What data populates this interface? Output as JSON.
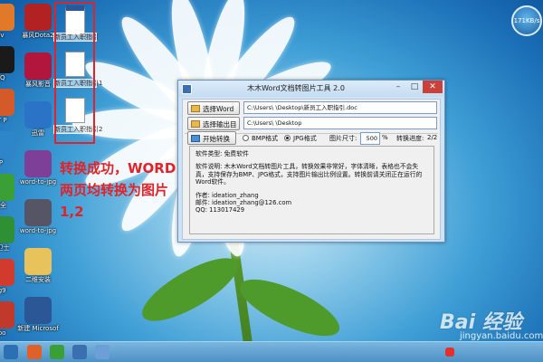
{
  "desktop": {
    "left_icons": [
      {
        "label": "ffv",
        "icon": "app-icon",
        "color": "#e07a2a"
      },
      {
        "label": "QQ",
        "icon": "qq-icon",
        "color": "#1a1a1a"
      },
      {
        "label": "ET P",
        "icon": "office-icon",
        "color": "#d55a2a"
      },
      {
        "label": "iP",
        "icon": "ie-icon",
        "color": "#2d86c9"
      },
      {
        "label": "安全",
        "icon": "security-icon",
        "color": "#3aa035"
      },
      {
        "label": "全卫士",
        "icon": "shield-icon",
        "color": "#2f8f34"
      },
      {
        "label": "eg9",
        "icon": "app-icon",
        "color": "#d03b2e"
      },
      {
        "label": "ypo",
        "icon": "app-icon",
        "color": "#c0392b"
      }
    ],
    "col2_icons": [
      {
        "label": "暴风Dota2",
        "icon": "dota-icon",
        "color": "#b22222"
      },
      {
        "label": "暴风影音",
        "icon": "media-player-icon",
        "color": "#b3163c"
      },
      {
        "label": "迅雷",
        "icon": "thunder-icon",
        "color": "#2a73c7"
      },
      {
        "label": "word-to-jpg",
        "icon": "winrar-icon",
        "color": "#7e3f98"
      },
      {
        "label": "word-to-jpg",
        "icon": "image-icon",
        "color": "#556"
      },
      {
        "label": "二维安装",
        "icon": "folder-icon",
        "color": "#e8c25a"
      },
      {
        "label": "新建 Microsof",
        "icon": "word-icon",
        "color": "#2b5797"
      }
    ],
    "doc_icons": [
      {
        "label": "新员工入职指引",
        "icon": "word-doc-icon"
      },
      {
        "label": "新员工入职指引1",
        "icon": "image-doc-icon"
      },
      {
        "label": "新员工入职指引2",
        "icon": "image-doc-icon"
      }
    ],
    "annotation": [
      "转换成功，WORD",
      "两页均转换为图片",
      "1,2"
    ],
    "speed": "171KB/s"
  },
  "window": {
    "title": "木木Word文档转图片工具 2.0",
    "select_word_button": "选择Word文件",
    "select_output_button": "选择输出目录",
    "word_path": "C:\\Users\\    \\Desktop\\新员工入职指引.doc",
    "output_path": "C:\\Users\\    \\Desktop",
    "start_button": "开始转换",
    "bmp_label": "BMP格式",
    "jpg_label": "JPG格式",
    "format_selected": "JPG格式",
    "size_label": "图片尺寸:",
    "size_value": "500",
    "size_unit": "%",
    "progress_label": "转换进度:",
    "progress_value": "2/2",
    "info": {
      "type_line": "软件类型: 免费软件",
      "desc": "软件说明: 木木Word文档转图片工具，转换效果非常好，字体清晰，表格也不会失真，支持保存为BMP、JPG格式，支持图片输出比例设置。转换前请关闭正在运行的Word软件。",
      "author": "作者: ideation_zhang",
      "email": "邮件: ideation_zhang@126.com",
      "qq": "QQ: 113017429"
    }
  },
  "watermark": "Bai 经验",
  "watermark_url": "jingyan.baidu.com"
}
